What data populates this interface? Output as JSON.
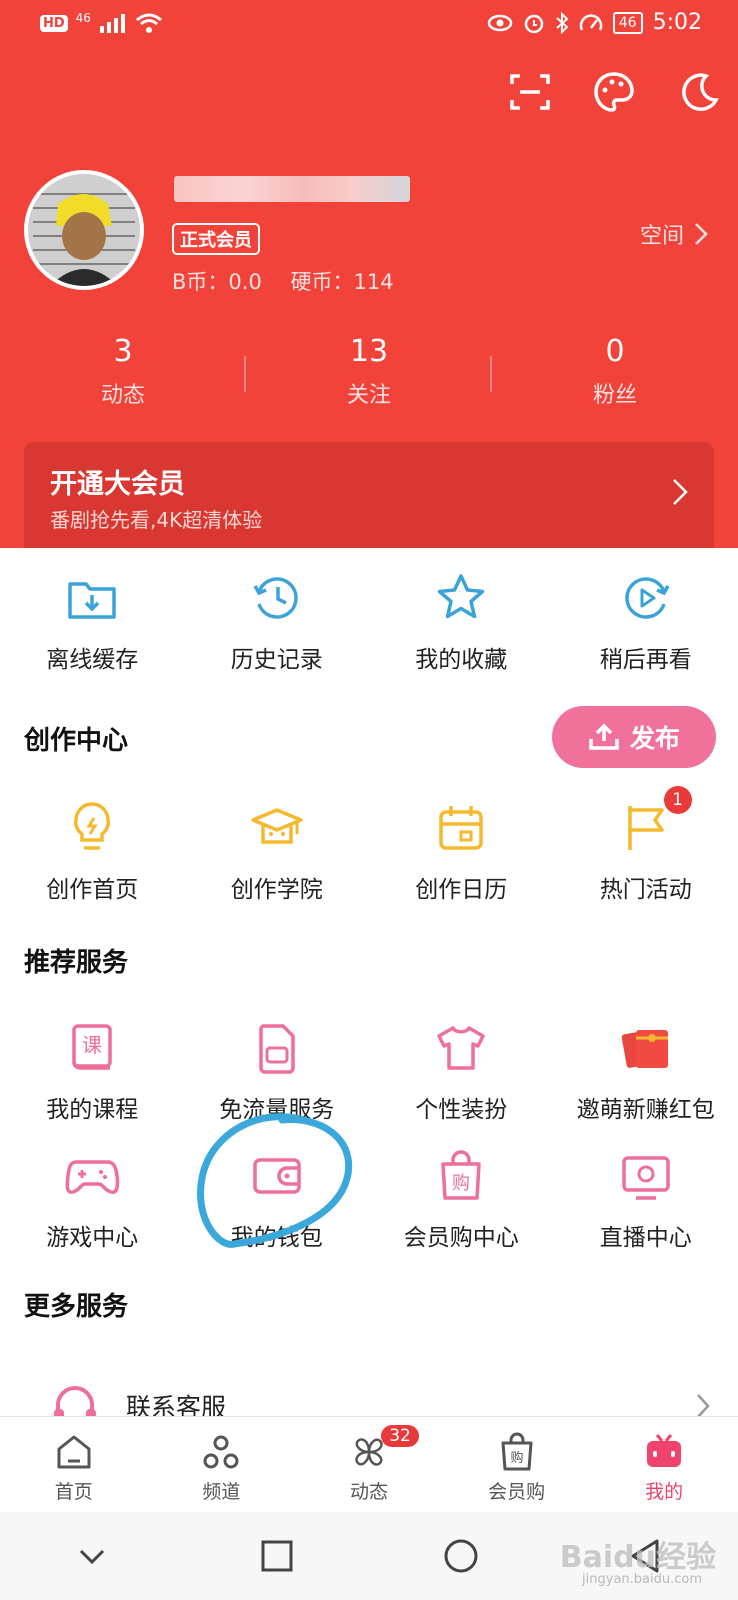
{
  "status_bar": {
    "hd": "HD",
    "network": "46",
    "battery": "46",
    "time": "5:02"
  },
  "profile": {
    "member_label": "正式会员",
    "bcoin": "B币：0.0",
    "coin": "硬币：114",
    "space_label": "空间"
  },
  "stats": [
    {
      "num": "3",
      "label": "动态"
    },
    {
      "num": "13",
      "label": "关注"
    },
    {
      "num": "0",
      "label": "粉丝"
    }
  ],
  "vip": {
    "title": "开通大会员",
    "subtitle": "番剧抢先看,4K超清体验"
  },
  "quick": [
    {
      "label": "离线缓存",
      "icon": "download-folder-icon"
    },
    {
      "label": "历史记录",
      "icon": "history-clock-icon"
    },
    {
      "label": "我的收藏",
      "icon": "star-icon"
    },
    {
      "label": "稍后再看",
      "icon": "play-later-icon"
    }
  ],
  "creation": {
    "title": "创作中心",
    "publish": "发布",
    "items": [
      {
        "label": "创作首页",
        "icon": "lightbulb-icon"
      },
      {
        "label": "创作学院",
        "icon": "graduation-cap-icon"
      },
      {
        "label": "创作日历",
        "icon": "calendar-icon"
      },
      {
        "label": "热门活动",
        "icon": "flag-icon",
        "badge": "1"
      }
    ]
  },
  "recommend": {
    "title": "推荐服务",
    "row1": [
      {
        "label": "我的课程",
        "icon": "course-book-icon",
        "glyph": "课"
      },
      {
        "label": "免流量服务",
        "icon": "sim-card-icon"
      },
      {
        "label": "个性装扮",
        "icon": "tshirt-icon"
      },
      {
        "label": "邀萌新赚红包",
        "icon": "red-envelope-icon"
      }
    ],
    "row2": [
      {
        "label": "游戏中心",
        "icon": "gamepad-icon"
      },
      {
        "label": "我的钱包",
        "icon": "wallet-icon"
      },
      {
        "label": "会员购中心",
        "icon": "shopping-bag-icon",
        "glyph": "购"
      },
      {
        "label": "直播中心",
        "icon": "tv-live-icon"
      }
    ]
  },
  "more": {
    "title": "更多服务",
    "items": [
      {
        "label": "联系客服",
        "icon": "headset-icon"
      }
    ]
  },
  "bottom_nav": [
    {
      "label": "首页",
      "icon": "home-icon"
    },
    {
      "label": "频道",
      "icon": "channel-icon"
    },
    {
      "label": "动态",
      "icon": "pinwheel-icon",
      "badge": "32"
    },
    {
      "label": "会员购",
      "icon": "shopping-bag-icon",
      "glyph": "购"
    },
    {
      "label": "我的",
      "icon": "tv-face-icon",
      "active": true
    }
  ],
  "watermark": {
    "text": "Baidu经验",
    "url": "jingyan.baidu.com"
  },
  "colors": {
    "header": "#f2433b",
    "accent_pink": "#f0729a",
    "blue_icon": "#3aa3d8",
    "yellow_icon": "#f5b82e",
    "pink_icon": "#ee6f97"
  }
}
